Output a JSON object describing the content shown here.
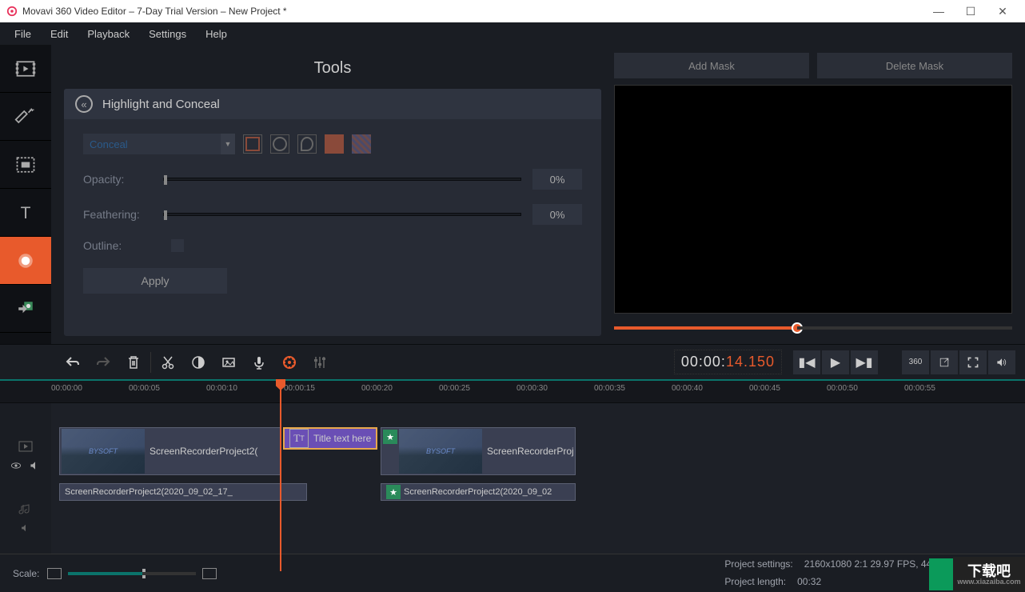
{
  "titlebar": {
    "title": "Movavi 360 Video Editor – 7-Day Trial Version – New Project *"
  },
  "menu": {
    "file": "File",
    "edit": "Edit",
    "playback": "Playback",
    "settings": "Settings",
    "help": "Help"
  },
  "tools": {
    "panel_title": "Tools",
    "section_title": "Highlight and Conceal",
    "mode_label": "Conceal",
    "opacity_label": "Opacity:",
    "opacity_value": "0%",
    "feathering_label": "Feathering:",
    "feathering_value": "0%",
    "outline_label": "Outline:",
    "apply_label": "Apply"
  },
  "preview": {
    "add_mask": "Add Mask",
    "delete_mask": "Delete Mask",
    "timecode_white": "00:00:",
    "timecode_orange": "14.150"
  },
  "ruler": {
    "ticks": [
      "00:00:00",
      "00:00:05",
      "00:00:10",
      "00:00:15",
      "00:00:20",
      "00:00:25",
      "00:00:30",
      "00:00:35",
      "00:00:40",
      "00:00:45",
      "00:00:50",
      "00:00:55"
    ]
  },
  "clips": {
    "video1_label": "ScreenRecorderProject2(",
    "video1_audio": "ScreenRecorderProject2(2020_09_02_17_",
    "title_label": "Title text here",
    "video2_label": "ScreenRecorderProj",
    "video2_audio": "ScreenRecorderProject2(2020_09_02",
    "thumb_text": "BYSOFT"
  },
  "footer": {
    "scale_label": "Scale:",
    "settings_label": "Project settings:",
    "settings_value": "2160x1080 2:1 29.97 FPS, 44100 Hz Stereo",
    "length_label": "Project length:",
    "length_value": "00:32"
  },
  "watermark": {
    "line1": "下载吧",
    "line2": "www.xiazaiba.com"
  }
}
